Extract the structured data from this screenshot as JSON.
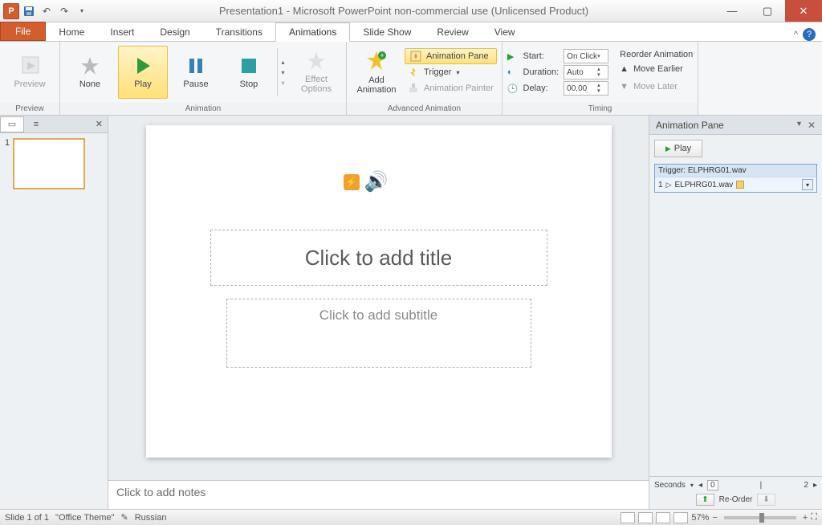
{
  "titlebar": {
    "app_letter": "P",
    "title": "Presentation1 - Microsoft PowerPoint non-commercial use (Unlicensed Product)"
  },
  "tabs": {
    "file": "File",
    "items": [
      "Home",
      "Insert",
      "Design",
      "Transitions",
      "Animations",
      "Slide Show",
      "Review",
      "View"
    ],
    "active_index": 4
  },
  "ribbon": {
    "preview": {
      "btn": "Preview",
      "group": "Preview"
    },
    "animation": {
      "none": "None",
      "play": "Play",
      "pause": "Pause",
      "stop": "Stop",
      "group": "Animation",
      "effect_options": "Effect\nOptions"
    },
    "advanced": {
      "add_animation": "Add\nAnimation",
      "anim_pane": "Animation Pane",
      "trigger": "Trigger",
      "painter": "Animation Painter",
      "group": "Advanced Animation"
    },
    "timing": {
      "start_label": "Start:",
      "start_value": "On Click",
      "duration_label": "Duration:",
      "duration_value": "Auto",
      "delay_label": "Delay:",
      "delay_value": "00,00",
      "reorder": "Reorder Animation",
      "earlier": "Move Earlier",
      "later": "Move Later",
      "group": "Timing"
    }
  },
  "thumbs": {
    "slide_number": "1"
  },
  "slide": {
    "title_placeholder": "Click to add title",
    "subtitle_placeholder": "Click to add subtitle"
  },
  "notes": {
    "placeholder": "Click to add notes"
  },
  "anim_pane": {
    "title": "Animation Pane",
    "play": "Play",
    "trigger_label": "Trigger: ELPHRG01.wav",
    "item_index": "1",
    "item_name": "ELPHRG01.wav",
    "seconds": "Seconds",
    "tick0": "0",
    "tick2": "2",
    "reorder": "Re-Order"
  },
  "statusbar": {
    "slide_info": "Slide 1 of 1",
    "theme": "\"Office Theme\"",
    "language": "Russian",
    "zoom": "57%"
  }
}
